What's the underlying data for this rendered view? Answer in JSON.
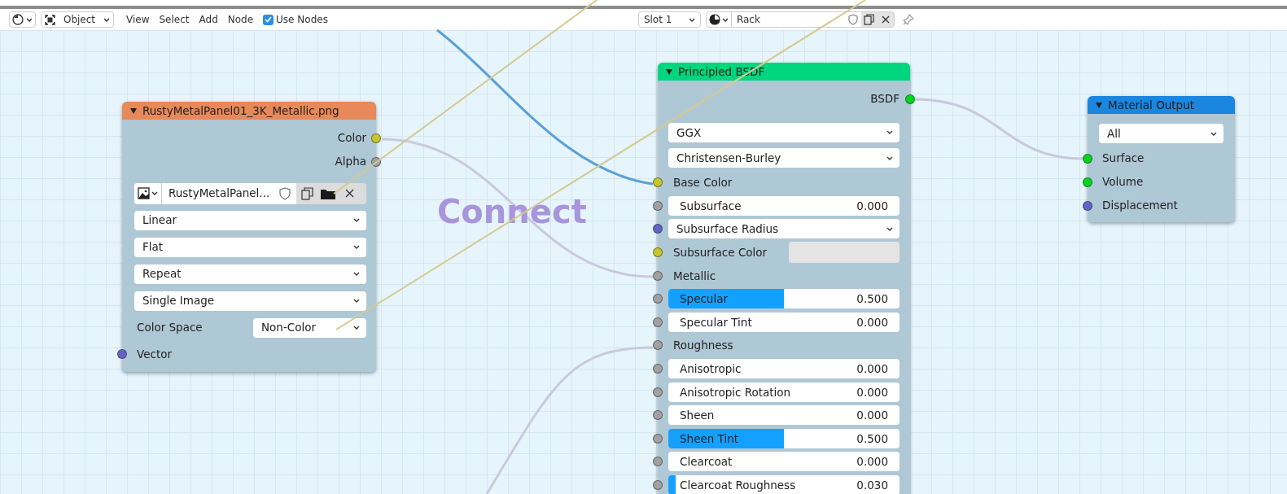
{
  "toolbar": {
    "mode": "Object",
    "menus": [
      "View",
      "Select",
      "Add",
      "Node"
    ],
    "use_nodes": {
      "label": "Use Nodes",
      "checked": true
    },
    "slot": "Slot 1",
    "material": "Rack"
  },
  "overlay_text": "Connect",
  "nodes": [
    {
      "title": "RustyMetalPanel01_3K_Metallic.png",
      "color": "#e8895a",
      "rows": [
        {
          "kind": "output",
          "label": "Color",
          "color": "#c7c729"
        },
        {
          "kind": "output",
          "label": "Alpha",
          "color": "#a1a1a1"
        },
        {
          "kind": "image",
          "value": "RustyMetalPanel..."
        },
        {
          "kind": "dropdown",
          "value": "Linear"
        },
        {
          "kind": "dropdown",
          "value": "Flat"
        },
        {
          "kind": "dropdown",
          "value": "Repeat"
        },
        {
          "kind": "dropdown",
          "value": "Single Image"
        },
        {
          "kind": "labeled_dropdown",
          "label": "Color Space",
          "value": "Non-Color"
        },
        {
          "kind": "input",
          "label": "Vector",
          "color": "#6363c7"
        }
      ]
    },
    {
      "title": "Principled BSDF",
      "color": "#00d67e",
      "rows": [
        {
          "kind": "output",
          "label": "BSDF",
          "color": "#00d61a"
        },
        {
          "kind": "dropdown",
          "value": "GGX"
        },
        {
          "kind": "dropdown",
          "value": "Christensen-Burley"
        },
        {
          "kind": "input",
          "label": "Base Color",
          "color": "#c7c729"
        },
        {
          "kind": "value",
          "label": "Subsurface",
          "value": "0.000",
          "level": 0,
          "color": "#a1a1a1"
        },
        {
          "kind": "socket_dropdown",
          "value": "Subsurface Radius",
          "color": "#6363c7"
        },
        {
          "kind": "color_field",
          "label": "Subsurface Color",
          "color": "#c7c729"
        },
        {
          "kind": "input",
          "label": "Metallic",
          "color": "#a1a1a1"
        },
        {
          "kind": "value",
          "label": "Specular",
          "value": "0.500",
          "level": 0.5,
          "color": "#a1a1a1"
        },
        {
          "kind": "value",
          "label": "Specular Tint",
          "value": "0.000",
          "level": 0,
          "color": "#a1a1a1"
        },
        {
          "kind": "input",
          "label": "Roughness",
          "color": "#a1a1a1"
        },
        {
          "kind": "value",
          "label": "Anisotropic",
          "value": "0.000",
          "level": 0,
          "color": "#a1a1a1"
        },
        {
          "kind": "value",
          "label": "Anisotropic Rotation",
          "value": "0.000",
          "level": 0,
          "color": "#a1a1a1"
        },
        {
          "kind": "value",
          "label": "Sheen",
          "value": "0.000",
          "level": 0,
          "color": "#a1a1a1"
        },
        {
          "kind": "value",
          "label": "Sheen Tint",
          "value": "0.500",
          "level": 0.5,
          "color": "#a1a1a1"
        },
        {
          "kind": "value",
          "label": "Clearcoat",
          "value": "0.000",
          "level": 0,
          "color": "#a1a1a1"
        },
        {
          "kind": "value",
          "label": "Clearcoat Roughness",
          "value": "0.030",
          "level": 0.03,
          "color": "#a1a1a1"
        }
      ]
    },
    {
      "title": "Material Output",
      "color": "#1a86e0",
      "rows": [
        {
          "kind": "dropdown",
          "value": "All"
        },
        {
          "kind": "input",
          "label": "Surface",
          "color": "#00d61a"
        },
        {
          "kind": "input",
          "label": "Volume",
          "color": "#00d61a"
        },
        {
          "kind": "input",
          "label": "Displacement",
          "color": "#6363c7"
        }
      ]
    }
  ]
}
